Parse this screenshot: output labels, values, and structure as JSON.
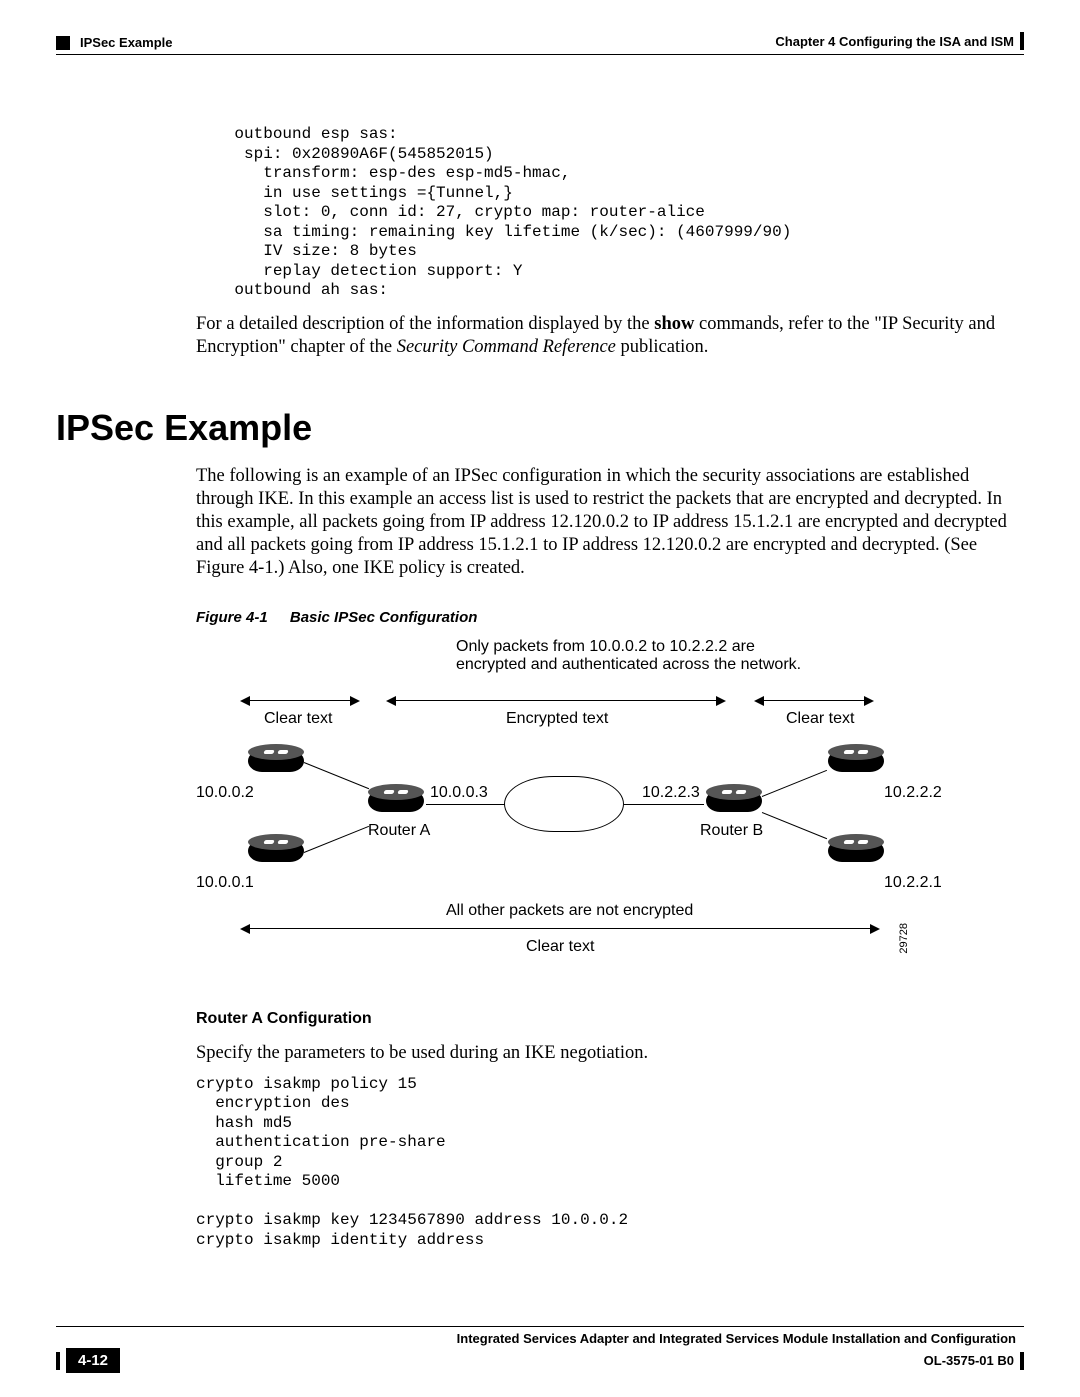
{
  "header": {
    "section": "IPSec Example",
    "chapter": "Chapter 4    Configuring the ISA and ISM"
  },
  "code1": "    outbound esp sas:\n     spi: 0x20890A6F(545852015)\n       transform: esp-des esp-md5-hmac,\n       in use settings ={Tunnel,}\n       slot: 0, conn id: 27, crypto map: router-alice\n       sa timing: remaining key lifetime (k/sec): (4607999/90)\n       IV size: 8 bytes\n       replay detection support: Y\n    outbound ah sas:",
  "para1_a": "For a detailed description of the information displayed by the ",
  "para1_b": "show",
  "para1_c": " commands, refer to the \"IP Security and Encryption\" chapter of the ",
  "para1_d": "Security Command Reference",
  "para1_e": " publication.",
  "section_title": "IPSec Example",
  "para2": "The following is an example of an IPSec configuration in which the security associations are established through IKE. In this example an access list is used to restrict the packets that are encrypted and decrypted. In this example, all packets going from IP address 12.120.0.2 to IP address 15.1.2.1 are encrypted and decrypted and all packets going from IP address 15.1.2.1 to IP address 12.120.0.2 are encrypted and decrypted. (See Figure 4-1.) Also, one IKE policy is created.",
  "figure": {
    "number": "Figure 4-1",
    "title": "Basic IPSec Configuration",
    "note_top": "Only packets from 10.0.0.2 to 10.2.2.2 are\nencrypted and authenticated across the network.",
    "clear_left": "Clear text",
    "encrypted": "Encrypted text",
    "clear_right": "Clear text",
    "ip_tl": "10.0.0.2",
    "ip_bl": "10.0.0.1",
    "ip_a": "10.0.0.3",
    "router_a": "Router A",
    "ip_b": "10.2.2.3",
    "router_b": "Router B",
    "ip_tr": "10.2.2.2",
    "ip_br": "10.2.2.1",
    "bottom_line1": "All other packets are not encrypted",
    "bottom_line2": "Clear text",
    "id": "29728"
  },
  "subheading": "Router A Configuration",
  "para3": "Specify the parameters to be used during an IKE negotiation.",
  "code2": "crypto isakmp policy 15\n  encryption des\n  hash md5\n  authentication pre-share\n  group 2\n  lifetime 5000\n\ncrypto isakmp key 1234567890 address 10.0.0.2\ncrypto isakmp identity address",
  "footer": {
    "title": "Integrated Services Adapter and Integrated Services Module Installation and Configuration",
    "page": "4-12",
    "docnum": "OL-3575-01 B0"
  }
}
